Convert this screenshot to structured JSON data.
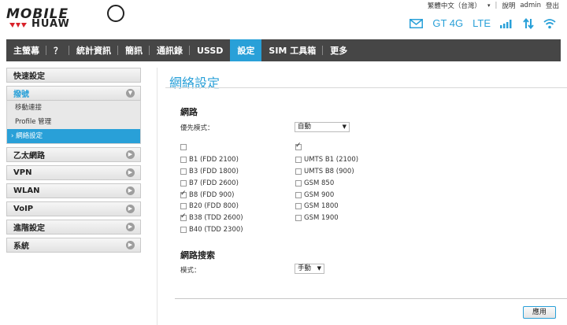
{
  "header": {
    "logo_text": "MOBILE",
    "logo_sub": "HUAW",
    "language": "繁體中文（台灣）",
    "help_label": "說明",
    "user_label": "admin",
    "logout_label": "登出",
    "network_name": "GT 4G",
    "network_type": "LTE"
  },
  "nav": {
    "items": [
      {
        "label": "主螢幕"
      },
      {
        "label": "？"
      },
      {
        "label": "統計資訊"
      },
      {
        "label": "簡訊"
      },
      {
        "label": "通訊錄"
      },
      {
        "label": "USSD"
      },
      {
        "label": "設定",
        "active": true
      },
      {
        "label": "SIM 工具箱"
      },
      {
        "label": "更多"
      }
    ]
  },
  "sidebar": {
    "quick_setup": "快速設定",
    "dialup": "撥號",
    "sub_items": [
      "移動連接",
      "Profile 管理",
      "網絡設定"
    ],
    "groups": [
      "乙太網路",
      "VPN",
      "WLAN",
      "VoIP",
      "進階設定",
      "系統"
    ]
  },
  "main": {
    "title": "網絡設定",
    "network_section": "網路",
    "preferred_mode_label": "優先模式：",
    "preferred_mode_value": "自動",
    "lte_bands": [
      {
        "label": "",
        "checked": false
      },
      {
        "label": "B1 (FDD 2100)",
        "checked": false
      },
      {
        "label": "B3 (FDD 1800)",
        "checked": false
      },
      {
        "label": "B7 (FDD 2600)",
        "checked": false
      },
      {
        "label": "B8 (FDD 900)",
        "checked": true
      },
      {
        "label": "B20 (FDD 800)",
        "checked": false
      },
      {
        "label": "B38 (TDD 2600)",
        "checked": true
      },
      {
        "label": "B40 (TDD 2300)",
        "checked": false
      }
    ],
    "other_bands": [
      {
        "label": "",
        "checked": true
      },
      {
        "label": "UMTS B1 (2100)",
        "checked": false
      },
      {
        "label": "UMTS B8 (900)",
        "checked": false
      },
      {
        "label": "GSM 850",
        "checked": false
      },
      {
        "label": "GSM 900",
        "checked": false
      },
      {
        "label": "GSM 1800",
        "checked": false
      },
      {
        "label": "GSM 1900",
        "checked": false
      }
    ],
    "search_section": "網路搜索",
    "mode_label": "模式：",
    "mode_value": "手動",
    "apply_label": "應用"
  },
  "colors": {
    "accent": "#29a0d8",
    "nav_bg": "#464646"
  }
}
